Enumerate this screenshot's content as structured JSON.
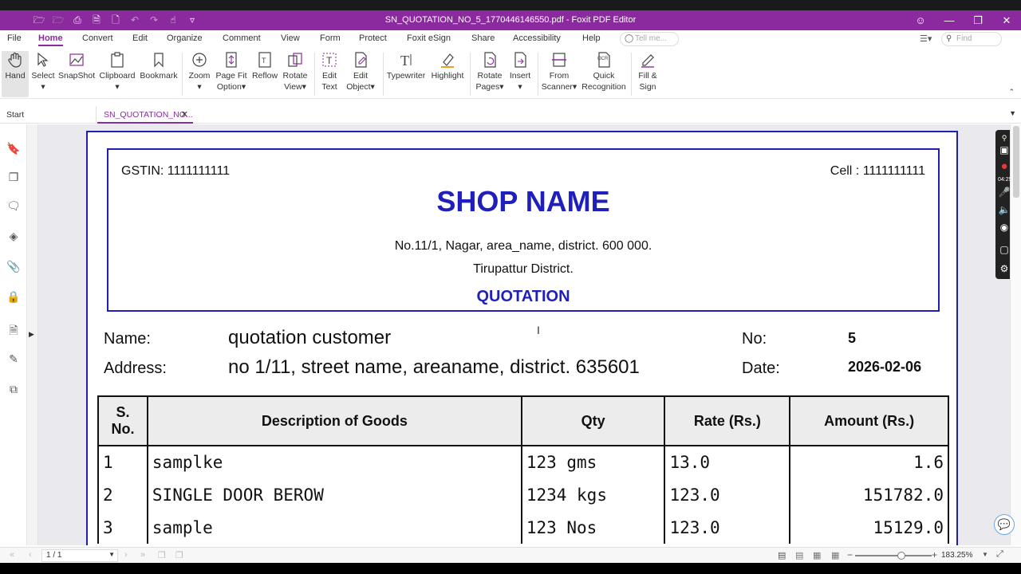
{
  "window": {
    "title": "SN_QUOTATION_NO_5_1770446146550.pdf - Foxit PDF Editor",
    "accent_color": "#8b2a9e"
  },
  "menu": [
    "File",
    "Home",
    "Convert",
    "Edit",
    "Organize",
    "Comment",
    "View",
    "Form",
    "Protect",
    "Foxit eSign",
    "Share",
    "Accessibility",
    "Help"
  ],
  "menu_active": "Home",
  "search": {
    "tellme_placeholder": "Tell me...",
    "find_placeholder": "Find"
  },
  "ribbon": [
    {
      "l1": "Hand",
      "l2": "",
      "icon": "hand-icon"
    },
    {
      "l1": "Select",
      "l2": "▾",
      "icon": "select-icon"
    },
    {
      "l1": "SnapShot",
      "l2": "",
      "icon": "snapshot-icon"
    },
    {
      "l1": "Clipboard",
      "l2": "▾",
      "icon": "clipboard-icon"
    },
    {
      "l1": "Bookmark",
      "l2": "",
      "icon": "bookmark-icon"
    },
    {
      "l1": "Zoom",
      "l2": "▾",
      "icon": "zoom-icon"
    },
    {
      "l1": "Page Fit",
      "l2": "Option▾",
      "icon": "page-fit-icon"
    },
    {
      "l1": "Reflow",
      "l2": "",
      "icon": "reflow-icon"
    },
    {
      "l1": "Rotate",
      "l2": "View▾",
      "icon": "rotate-view-icon"
    },
    {
      "l1": "Edit",
      "l2": "Text",
      "icon": "edit-text-icon"
    },
    {
      "l1": "Edit",
      "l2": "Object▾",
      "icon": "edit-object-icon"
    },
    {
      "l1": "Typewriter",
      "l2": "",
      "icon": "typewriter-icon"
    },
    {
      "l1": "Highlight",
      "l2": "",
      "icon": "highlight-icon"
    },
    {
      "l1": "Rotate",
      "l2": "Pages▾",
      "icon": "rotate-pages-icon"
    },
    {
      "l1": "Insert",
      "l2": "▾",
      "icon": "insert-icon"
    },
    {
      "l1": "From",
      "l2": "Scanner▾",
      "icon": "scanner-icon"
    },
    {
      "l1": "Quick",
      "l2": "Recognition",
      "icon": "ocr-icon"
    },
    {
      "l1": "Fill &",
      "l2": "Sign",
      "icon": "fill-sign-icon"
    }
  ],
  "tabs": {
    "start": "Start",
    "doc": "SN_QUOTATION_NO..."
  },
  "doc": {
    "gstin": "GSTIN: 1111111111",
    "cell": "Cell : 1111111111",
    "shop_name": "SHOP NAME",
    "address1": "No.11/1, Nagar, area_name, district. 600 000.",
    "address2": "Tirupattur District.",
    "heading": "QUOTATION",
    "name_label": "Name:",
    "name_value": "quotation customer",
    "address_label": "Address:",
    "address_value": "no 1/11, street name, areaname, district. 635601",
    "no_label": "No:",
    "no_value": "5",
    "date_label": "Date:",
    "date_value": "2026-02-06",
    "table": {
      "headers": [
        "S.\nNo.",
        "Description of Goods",
        "Qty",
        "Rate (Rs.)",
        "Amount (Rs.)"
      ],
      "rows": [
        [
          "1",
          "samplke",
          "123 gms",
          "13.0",
          "1.6"
        ],
        [
          "2",
          "SINGLE DOOR BEROW",
          "1234 kgs",
          "123.0",
          "151782.0"
        ],
        [
          "3",
          "sample",
          "123 Nos",
          "123.0",
          "15129.0"
        ]
      ]
    }
  },
  "recorder": {
    "time": "04:25"
  },
  "status": {
    "page": "1 / 1",
    "zoom": "183.25%",
    "zoom_slider_fraction": 0.6
  }
}
